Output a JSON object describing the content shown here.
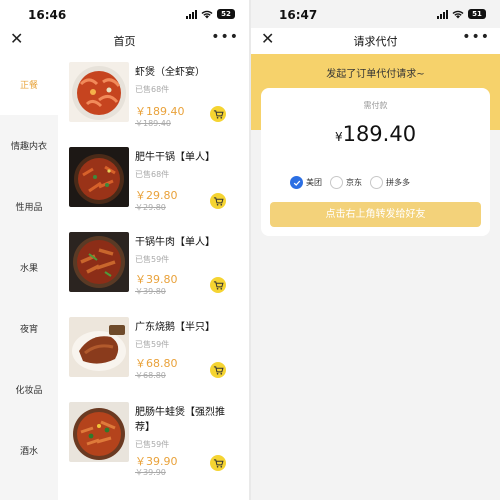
{
  "left": {
    "status": {
      "time": "16:46",
      "battery": "52"
    },
    "nav": {
      "title": "首页",
      "close_icon": "close-icon",
      "more_icon": "more-icon"
    },
    "categories": [
      {
        "label": "正餐",
        "active": true
      },
      {
        "label": "情趣内衣",
        "active": false
      },
      {
        "label": "性用品",
        "active": false
      },
      {
        "label": "水果",
        "active": false
      },
      {
        "label": "夜宵",
        "active": false
      },
      {
        "label": "化妆品",
        "active": false
      },
      {
        "label": "酒水",
        "active": false
      }
    ],
    "products": [
      {
        "name": "虾煲（全虾宴）",
        "sold": "已售68件",
        "price": "￥189.40",
        "original": "￥189.40",
        "image": "shrimp-pot-photo"
      },
      {
        "name": "肥牛干锅【单人】",
        "sold": "已售68件",
        "price": "￥29.80",
        "original": "￥29.80",
        "image": "beef-dry-pot-photo"
      },
      {
        "name": "干锅牛肉【单人】",
        "sold": "已售59件",
        "price": "￥39.80",
        "original": "￥39.80",
        "image": "dry-pot-beef-photo"
      },
      {
        "name": "广东烧鹅【半只】",
        "sold": "已售59件",
        "price": "￥68.80",
        "original": "￥68.80",
        "image": "roast-goose-photo"
      },
      {
        "name": "肥肠牛蛙煲【强烈推荐】",
        "sold": "已售59件",
        "price": "￥39.90",
        "original": "￥39.90",
        "image": "bullfrog-pot-photo"
      }
    ]
  },
  "right": {
    "status": {
      "time": "16:47",
      "battery": "51"
    },
    "nav": {
      "title": "请求代付",
      "close_icon": "close-icon",
      "more_icon": "more-icon"
    },
    "banner": "发起了订单代付请求~",
    "card": {
      "label": "需付款",
      "currency": "¥",
      "amount": "189.40",
      "options": [
        {
          "label": "美团",
          "selected": true
        },
        {
          "label": "京东",
          "selected": false
        },
        {
          "label": "拼多多",
          "selected": false
        }
      ],
      "share_button": "点击右上角转发给好友"
    }
  },
  "colors": {
    "accent": "#e9a23b",
    "banner": "#f6d26b",
    "cart": "#f5d432",
    "radio_on": "#2c6fe3"
  }
}
